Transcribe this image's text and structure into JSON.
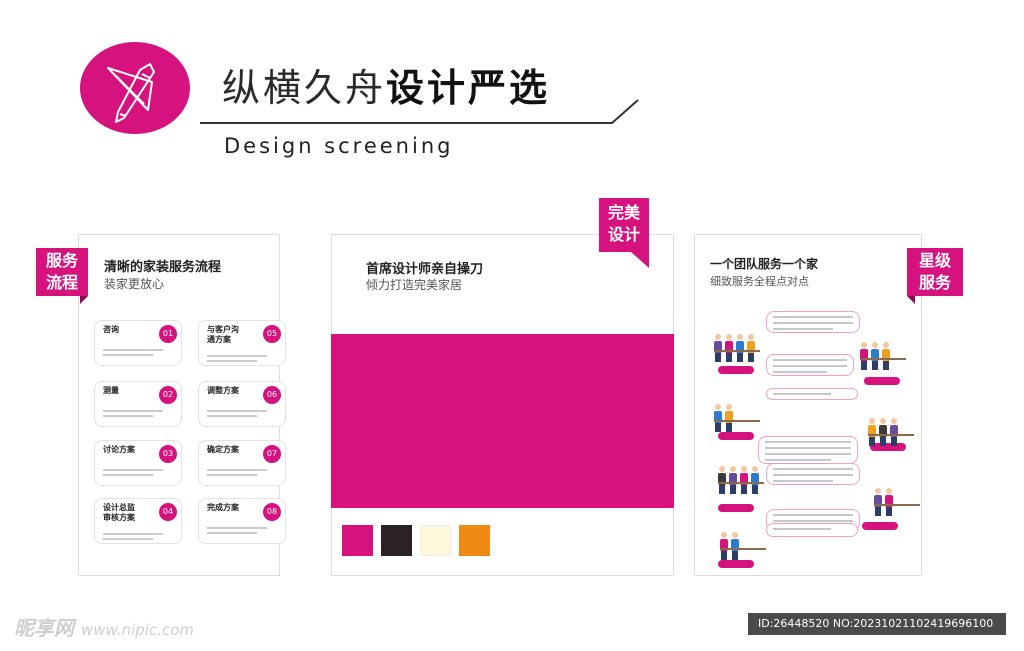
{
  "header": {
    "title_normal": "纵横久舟",
    "title_bold": "设计严选",
    "subtitle": "Design screening"
  },
  "colors": {
    "accent": "#d6127f"
  },
  "icons": {
    "logo": "pencil-ruler-icon"
  },
  "panel1": {
    "tag": [
      "服务",
      "流程"
    ],
    "heading": "清晰的家装服务流程",
    "sub": "装家更放心",
    "steps": [
      {
        "name": "咨询",
        "num": "01"
      },
      {
        "name": "测量",
        "num": "02"
      },
      {
        "name": "讨论方案",
        "num": "03"
      },
      {
        "name": "设计总监审核方案",
        "num": "04"
      },
      {
        "name": "与客户沟通方案",
        "num": "05"
      },
      {
        "name": "调整方案",
        "num": "06"
      },
      {
        "name": "确定方案",
        "num": "07"
      },
      {
        "name": "完成方案",
        "num": "08"
      }
    ]
  },
  "panel2": {
    "tag": [
      "完美",
      "设计"
    ],
    "heading": "首席设计师亲自操刀",
    "sub": "倾力打造完美家居",
    "swatches": [
      "#d6127f",
      "#2b2323",
      "#fdf8dc",
      "#f08a14"
    ]
  },
  "panel3": {
    "tag": [
      "星级",
      "服务"
    ],
    "heading": "一个团队服务一个家",
    "sub": "细致服务全程点对点"
  },
  "watermark": {
    "brand": "昵享网",
    "url": "www.nipic.com"
  },
  "image_id": "ID:26448520 NO:20231021102419696100"
}
